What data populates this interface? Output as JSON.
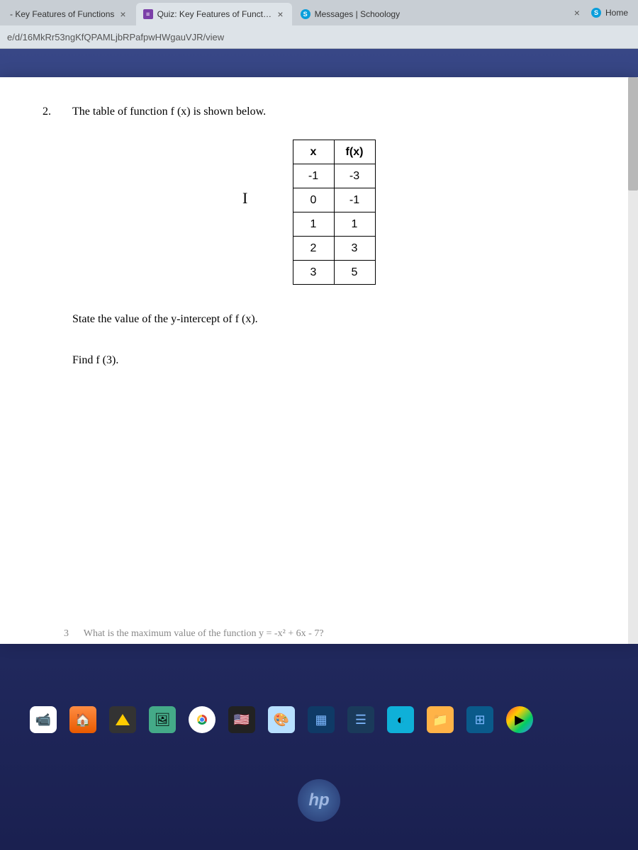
{
  "tabs": [
    {
      "title": "- Key Features of Functions",
      "icon": ""
    },
    {
      "title": "Quiz: Key Features of Functions",
      "icon": "forms"
    },
    {
      "title": "Messages | Schoology",
      "icon": "schoology"
    }
  ],
  "right_tab": {
    "title": "Home",
    "icon": "schoology"
  },
  "url": "e/d/16MkRr53ngKfQPAMLjbRPafpwHWgauVJR/view",
  "question": {
    "number": "2.",
    "prompt": "The table of function f (x) is shown below.",
    "table": {
      "headers": [
        "x",
        "f(x)"
      ],
      "rows": [
        [
          "-1",
          "-3"
        ],
        [
          "0",
          "-1"
        ],
        [
          "1",
          "1"
        ],
        [
          "2",
          "3"
        ],
        [
          "3",
          "5"
        ]
      ]
    },
    "sub_a": "State the value of the y-intercept of f (x).",
    "sub_b": "Find f (3).",
    "cursor": "I"
  },
  "cutoff": {
    "num": "3",
    "text": "What is the maximum value of the function y = -x² + 6x - 7?"
  },
  "hp": "hp"
}
